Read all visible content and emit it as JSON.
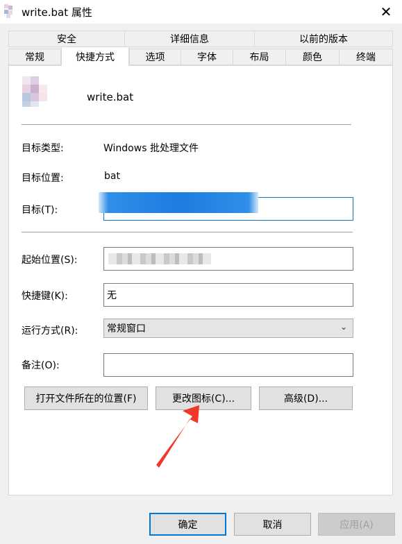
{
  "window": {
    "title": "write.bat 属性"
  },
  "tabs_row1": [
    {
      "label": "安全"
    },
    {
      "label": "详细信息"
    },
    {
      "label": "以前的版本"
    }
  ],
  "tabs_row2": [
    {
      "label": "常规"
    },
    {
      "label": "快捷方式"
    },
    {
      "label": "选项"
    },
    {
      "label": "字体"
    },
    {
      "label": "布局"
    },
    {
      "label": "颜色"
    },
    {
      "label": "终端"
    }
  ],
  "shortcut": {
    "filename": "write.bat",
    "target_type_label": "目标类型:",
    "target_type_value": "Windows 批处理文件",
    "target_location_label": "目标位置:",
    "target_location_value": "bat",
    "target_label": "目标(T):",
    "target_value": "",
    "start_in_label": "起始位置(S):",
    "start_in_value": "",
    "hotkey_label": "快捷键(K):",
    "hotkey_value": "无",
    "run_label": "运行方式(R):",
    "run_value": "常规窗口",
    "comment_label": "备注(O):",
    "comment_value": "",
    "open_location_button": "打开文件所在的位置(F)",
    "change_icon_button": "更改图标(C)...",
    "advanced_button": "高级(D)..."
  },
  "footer": {
    "ok": "确定",
    "cancel": "取消",
    "apply": "应用(A)"
  },
  "colors": {
    "accent": "#0078d7",
    "annotation_arrow": "#f0372a"
  }
}
